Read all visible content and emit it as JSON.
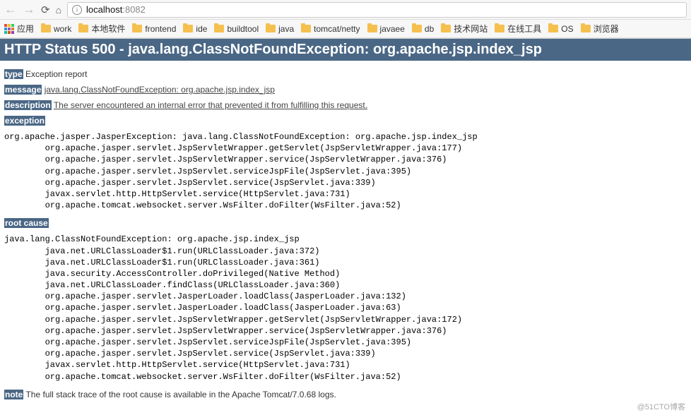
{
  "browser": {
    "url_host": "localhost",
    "url_port": ":8082",
    "apps_label": "应用",
    "bookmarks": [
      "work",
      "本地软件",
      "frontend",
      "ide",
      "buildtool",
      "java",
      "tomcat/netty",
      "javaee",
      "db",
      "技术网站",
      "在线工具",
      "OS",
      "浏览器"
    ]
  },
  "error": {
    "header": "HTTP Status 500 - java.lang.ClassNotFoundException: org.apache.jsp.index_jsp",
    "labels": {
      "type": "type",
      "message": "message",
      "description": "description",
      "exception": "exception",
      "root_cause": "root cause",
      "note": "note"
    },
    "type_text": "Exception report",
    "message_text": "java.lang.ClassNotFoundException: org.apache.jsp.index_jsp",
    "description_text": "The server encountered an internal error that prevented it from fulfilling this request.",
    "exception_trace": "org.apache.jasper.JasperException: java.lang.ClassNotFoundException: org.apache.jsp.index_jsp\n        org.apache.jasper.servlet.JspServletWrapper.getServlet(JspServletWrapper.java:177)\n        org.apache.jasper.servlet.JspServletWrapper.service(JspServletWrapper.java:376)\n        org.apache.jasper.servlet.JspServlet.serviceJspFile(JspServlet.java:395)\n        org.apache.jasper.servlet.JspServlet.service(JspServlet.java:339)\n        javax.servlet.http.HttpServlet.service(HttpServlet.java:731)\n        org.apache.tomcat.websocket.server.WsFilter.doFilter(WsFilter.java:52)",
    "root_cause_trace": "java.lang.ClassNotFoundException: org.apache.jsp.index_jsp\n        java.net.URLClassLoader$1.run(URLClassLoader.java:372)\n        java.net.URLClassLoader$1.run(URLClassLoader.java:361)\n        java.security.AccessController.doPrivileged(Native Method)\n        java.net.URLClassLoader.findClass(URLClassLoader.java:360)\n        org.apache.jasper.servlet.JasperLoader.loadClass(JasperLoader.java:132)\n        org.apache.jasper.servlet.JasperLoader.loadClass(JasperLoader.java:63)\n        org.apache.jasper.servlet.JspServletWrapper.getServlet(JspServletWrapper.java:172)\n        org.apache.jasper.servlet.JspServletWrapper.service(JspServletWrapper.java:376)\n        org.apache.jasper.servlet.JspServlet.serviceJspFile(JspServlet.java:395)\n        org.apache.jasper.servlet.JspServlet.service(JspServlet.java:339)\n        javax.servlet.http.HttpServlet.service(HttpServlet.java:731)\n        org.apache.tomcat.websocket.server.WsFilter.doFilter(WsFilter.java:52)",
    "note_text": "The full stack trace of the root cause is available in the Apache Tomcat/7.0.68 logs."
  },
  "watermark": "@51CTO博客"
}
